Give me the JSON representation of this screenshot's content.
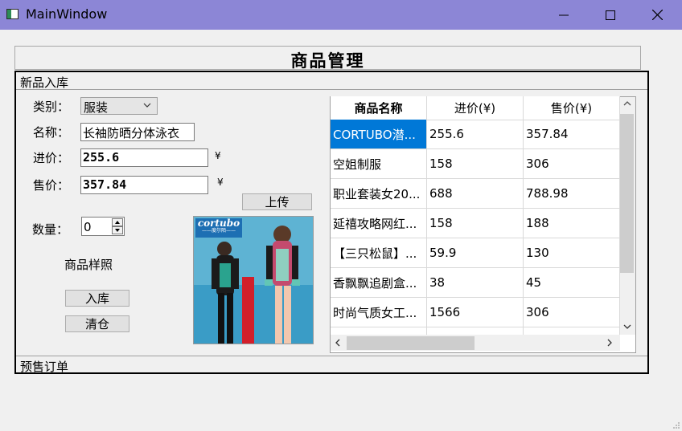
{
  "window": {
    "title": "MainWindow"
  },
  "header": {
    "title": "商品管理"
  },
  "tabs": {
    "new_stock": "新品入库",
    "presale": "预售订单"
  },
  "form": {
    "category_label": "类别：",
    "category_value": "服装",
    "name_label": "名称：",
    "name_value": "长袖防晒分体泳衣",
    "cost_label": "进价：",
    "cost_value": "255.6",
    "price_label": "售价：",
    "price_value": "357.84",
    "currency": "¥",
    "upload_button": "上传",
    "quantity_label": "数量：",
    "quantity_value": "0",
    "sample_label": "商品样照",
    "stock_in_button": "入库",
    "clear_button": "清仓"
  },
  "image": {
    "brand": "cortubo",
    "brand_sub": "——度尔陌——"
  },
  "table": {
    "columns": [
      "商品名称",
      "进价(¥)",
      "售价(¥)"
    ],
    "rows": [
      [
        "CORTUBO潜...",
        "255.6",
        "357.84"
      ],
      [
        "空姐制服",
        "158",
        "306"
      ],
      [
        "职业套装女20...",
        "688",
        "788.98"
      ],
      [
        "延禧攻略网红...",
        "158",
        "188"
      ],
      [
        "【三只松鼠】...",
        "59.9",
        "130"
      ],
      [
        "香飘飘追剧盒...",
        "38",
        "45"
      ],
      [
        "时尚气质女工...",
        "1566",
        "306"
      ]
    ]
  },
  "colors": {
    "titlebar": "#8c86d6",
    "selection": "#0078d7"
  }
}
